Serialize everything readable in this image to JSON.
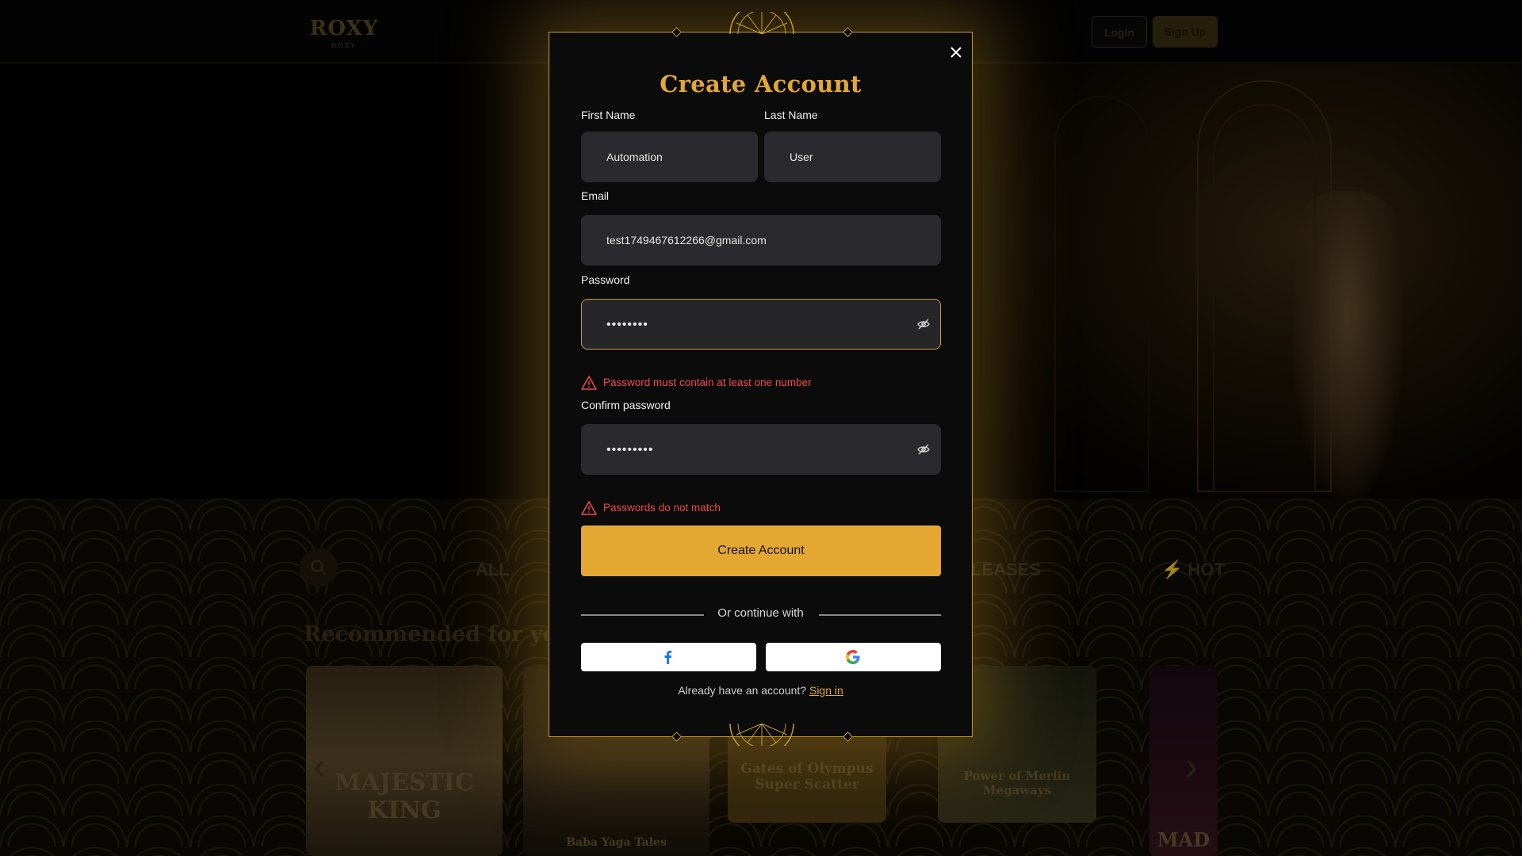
{
  "background": {
    "logo": {
      "main": "ROXY",
      "sub": "ROXY"
    },
    "header": {
      "login_label": "Login",
      "signup_label": "Sign Up"
    },
    "categories": [
      "ALL",
      "LEASES",
      "HOT"
    ],
    "recommended_title": "Recommended for you",
    "games": [
      "MAJESTIC KING",
      "Baba Yaga Tales",
      "Gates of Olympus Super Scatter",
      "Power of Merlin Megaways",
      "MAD"
    ]
  },
  "modal": {
    "title": "Create Account",
    "first_name": {
      "label": "First Name",
      "value": "Automation"
    },
    "last_name": {
      "label": "Last Name",
      "value": "User"
    },
    "email": {
      "label": "Email",
      "value": "test1749467612266@gmail.com"
    },
    "password": {
      "label": "Password",
      "value": "••••••••",
      "error": "Password must contain at least one number"
    },
    "confirm_password": {
      "label": "Confirm password",
      "value": "•••••••••",
      "error": "Passwords do not match"
    },
    "submit_label": "Create Account",
    "divider_text": "Or continue with",
    "social": [
      "facebook-icon",
      "google-icon"
    ],
    "signin_prompt": "Already have an account?",
    "signin_link": "Sign in"
  },
  "colors": {
    "accent": "#e3a732",
    "error": "#f04848",
    "modal_bg": "#0b0b0c",
    "field_bg": "#2a2a2e"
  }
}
